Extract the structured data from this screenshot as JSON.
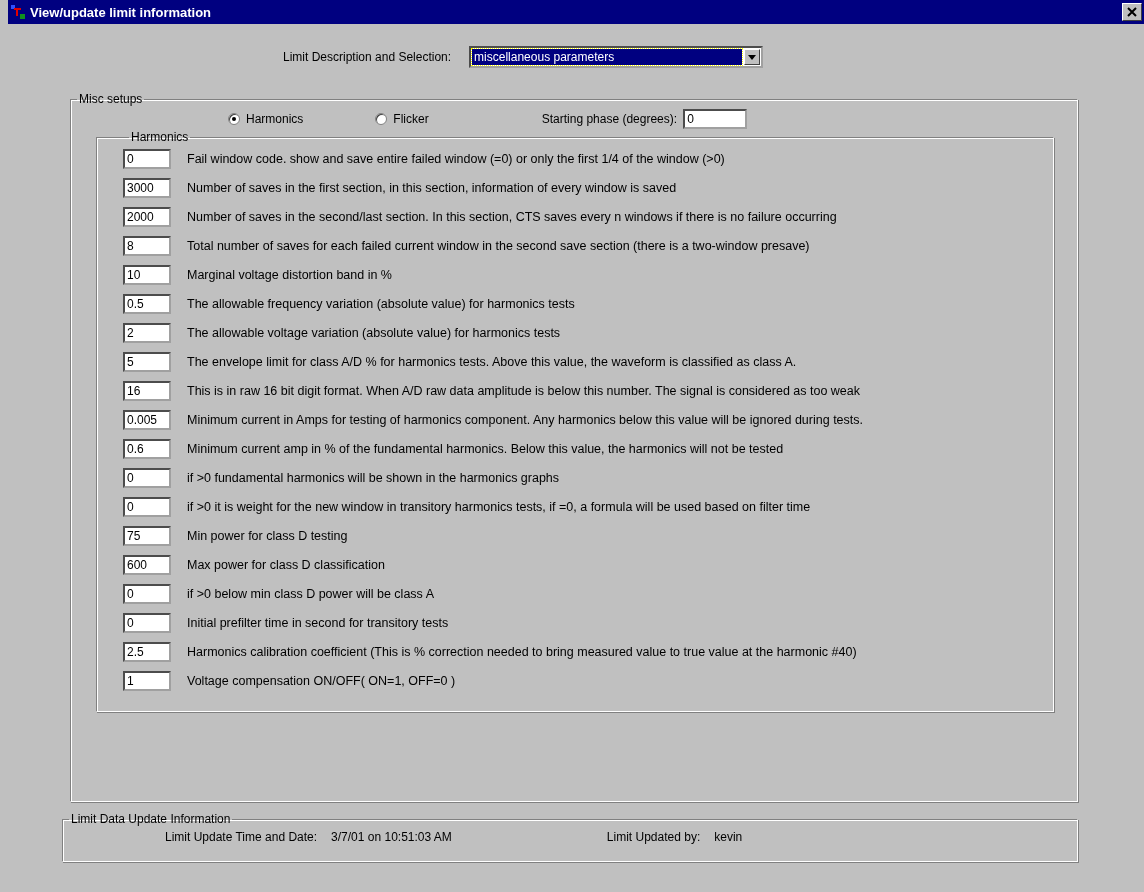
{
  "window": {
    "title": "View/update limit information"
  },
  "selector": {
    "label": "Limit Description and Selection:",
    "value": "miscellaneous parameters"
  },
  "misc_setups": {
    "title": "Misc setups",
    "radios": [
      {
        "label": "Harmonics",
        "selected": true
      },
      {
        "label": "Flicker",
        "selected": false
      }
    ],
    "starting_phase": {
      "label": "Starting phase (degrees):",
      "value": "0"
    },
    "harmonics": {
      "title": "Harmonics",
      "params": [
        {
          "value": "0",
          "description": "Fail window code. show and save entire failed window (=0) or only the first 1/4 of the window (>0)"
        },
        {
          "value": "3000",
          "description": "Number of saves in the first section, in this section, information of every window is saved"
        },
        {
          "value": "2000",
          "description": "Number of saves in the second/last section.  In this section, CTS saves every n windows if there is no failure occurring"
        },
        {
          "value": "8",
          "description": "Total number of saves for each failed current window in the second save section (there is a two-window presave)"
        },
        {
          "value": "10",
          "description": "Marginal voltage distortion band in %"
        },
        {
          "value": "0.5",
          "description": "The allowable frequency variation (absolute value)  for harmonics tests"
        },
        {
          "value": "2",
          "description": "The allowable voltage  variation  (absolute value) for harmonics tests"
        },
        {
          "value": "5",
          "description": "The envelope limit for class A/D %  for harmonics tests.  Above this value, the waveform is classified as class A."
        },
        {
          "value": "16",
          "description": "This is in raw 16 bit digit format.  When A/D raw data amplitude is below this number.  The signal is considered as too weak"
        },
        {
          "value": "0.005",
          "description": "Minimum current in Amps for testing of harmonics component. Any harmonics below this value will be ignored during tests."
        },
        {
          "value": "0.6",
          "description": "Minimum current amp in % of the fundamental harmonics.  Below this value, the harmonics will not be tested"
        },
        {
          "value": "0",
          "description": "if >0  fundamental harmonics will be shown in the harmonics graphs"
        },
        {
          "value": "0",
          "description": "if >0 it is weight for the new window in transitory harmonics tests, if =0, a formula will be used based on filter time"
        },
        {
          "value": "75",
          "description": "Min power for class D testing"
        },
        {
          "value": "600",
          "description": "Max power for class D classification"
        },
        {
          "value": "0",
          "description": "if >0 below min class D power will be class A"
        },
        {
          "value": "0",
          "description": "Initial prefilter time in second for transitory tests"
        },
        {
          "value": "2.5",
          "description": "Harmonics calibration coefficient (This is % correction needed to bring measured value to true value at the harmonic #40)"
        },
        {
          "value": "1",
          "description": "Voltage compensation ON/OFF( ON=1, OFF=0 )"
        }
      ]
    }
  },
  "update_info": {
    "title": "Limit Data Update Information",
    "time_label": "Limit Update Time and Date:",
    "time_value": "3/7/01 on 10:51:03 AM",
    "by_label": "Limit Updated by:",
    "by_value": "kevin"
  }
}
